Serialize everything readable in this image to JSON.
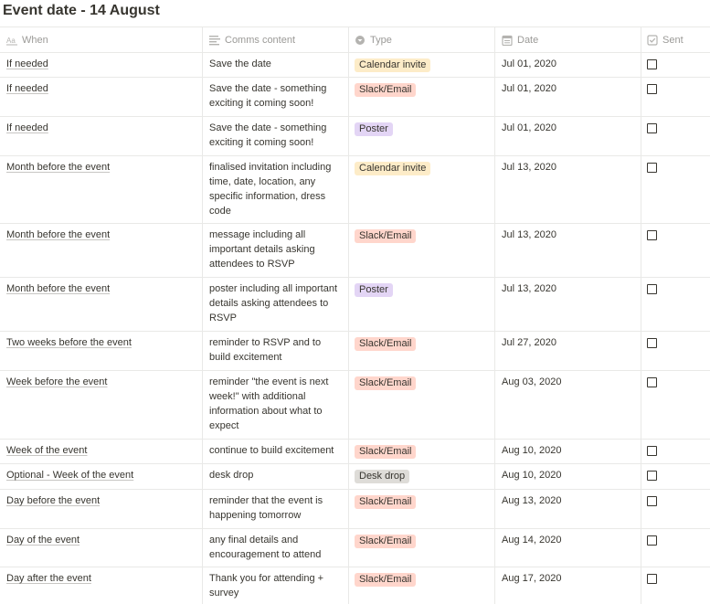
{
  "page": {
    "title": "Event date - 14 August"
  },
  "header": {
    "when": "When",
    "comms": "Comms content",
    "type": "Type",
    "date": "Date",
    "sent": "Sent"
  },
  "type_colors": {
    "Calendar invite": "#fdecc8",
    "Slack/Email": "#ffd6cc",
    "Poster": "#e3d5f5",
    "Desk drop": "#dedcd8"
  },
  "rows": [
    {
      "when": "If needed",
      "comms": "Save the date",
      "type": "Calendar invite",
      "date": "Jul 01, 2020",
      "sent": false
    },
    {
      "when": "If needed",
      "comms": "Save the date - something exciting it coming soon!",
      "type": "Slack/Email",
      "date": "Jul 01, 2020",
      "sent": false
    },
    {
      "when": "If needed",
      "comms": "Save the date - something exciting it coming soon!",
      "type": "Poster",
      "date": "Jul 01, 2020",
      "sent": false
    },
    {
      "when": "Month before the event",
      "comms": "finalised invitation including time, date, location, any specific information, dress code",
      "type": "Calendar invite",
      "date": "Jul 13, 2020",
      "sent": false
    },
    {
      "when": "Month before the event",
      "comms": "message including all important details asking attendees to RSVP",
      "type": "Slack/Email",
      "date": "Jul 13, 2020",
      "sent": false
    },
    {
      "when": "Month before the event",
      "comms": "poster including all important details asking attendees to RSVP",
      "type": "Poster",
      "date": "Jul 13, 2020",
      "sent": false
    },
    {
      "when": "Two weeks before the event",
      "comms": "reminder to RSVP and to build excitement",
      "type": "Slack/Email",
      "date": "Jul 27, 2020",
      "sent": false
    },
    {
      "when": "Week before the event",
      "comms": "reminder \"the event is next week!\" with additional information about what to expect",
      "type": "Slack/Email",
      "date": "Aug 03, 2020",
      "sent": false
    },
    {
      "when": "Week of the event",
      "comms": "continue to build excitement",
      "type": "Slack/Email",
      "date": "Aug 10, 2020",
      "sent": false
    },
    {
      "when": "Optional - Week of the event",
      "comms": "desk drop",
      "type": "Desk drop",
      "date": "Aug 10, 2020",
      "sent": false
    },
    {
      "when": "Day before the event",
      "comms": "reminder that the event is happening tomorrow",
      "type": "Slack/Email",
      "date": "Aug 13, 2020",
      "sent": false
    },
    {
      "when": "Day of the event",
      "comms": "any final details and encouragement to attend",
      "type": "Slack/Email",
      "date": "Aug 14, 2020",
      "sent": false
    },
    {
      "when": "Day after the event",
      "comms": "Thank you for attending + survey",
      "type": "Slack/Email",
      "date": "Aug 17, 2020",
      "sent": false
    }
  ]
}
